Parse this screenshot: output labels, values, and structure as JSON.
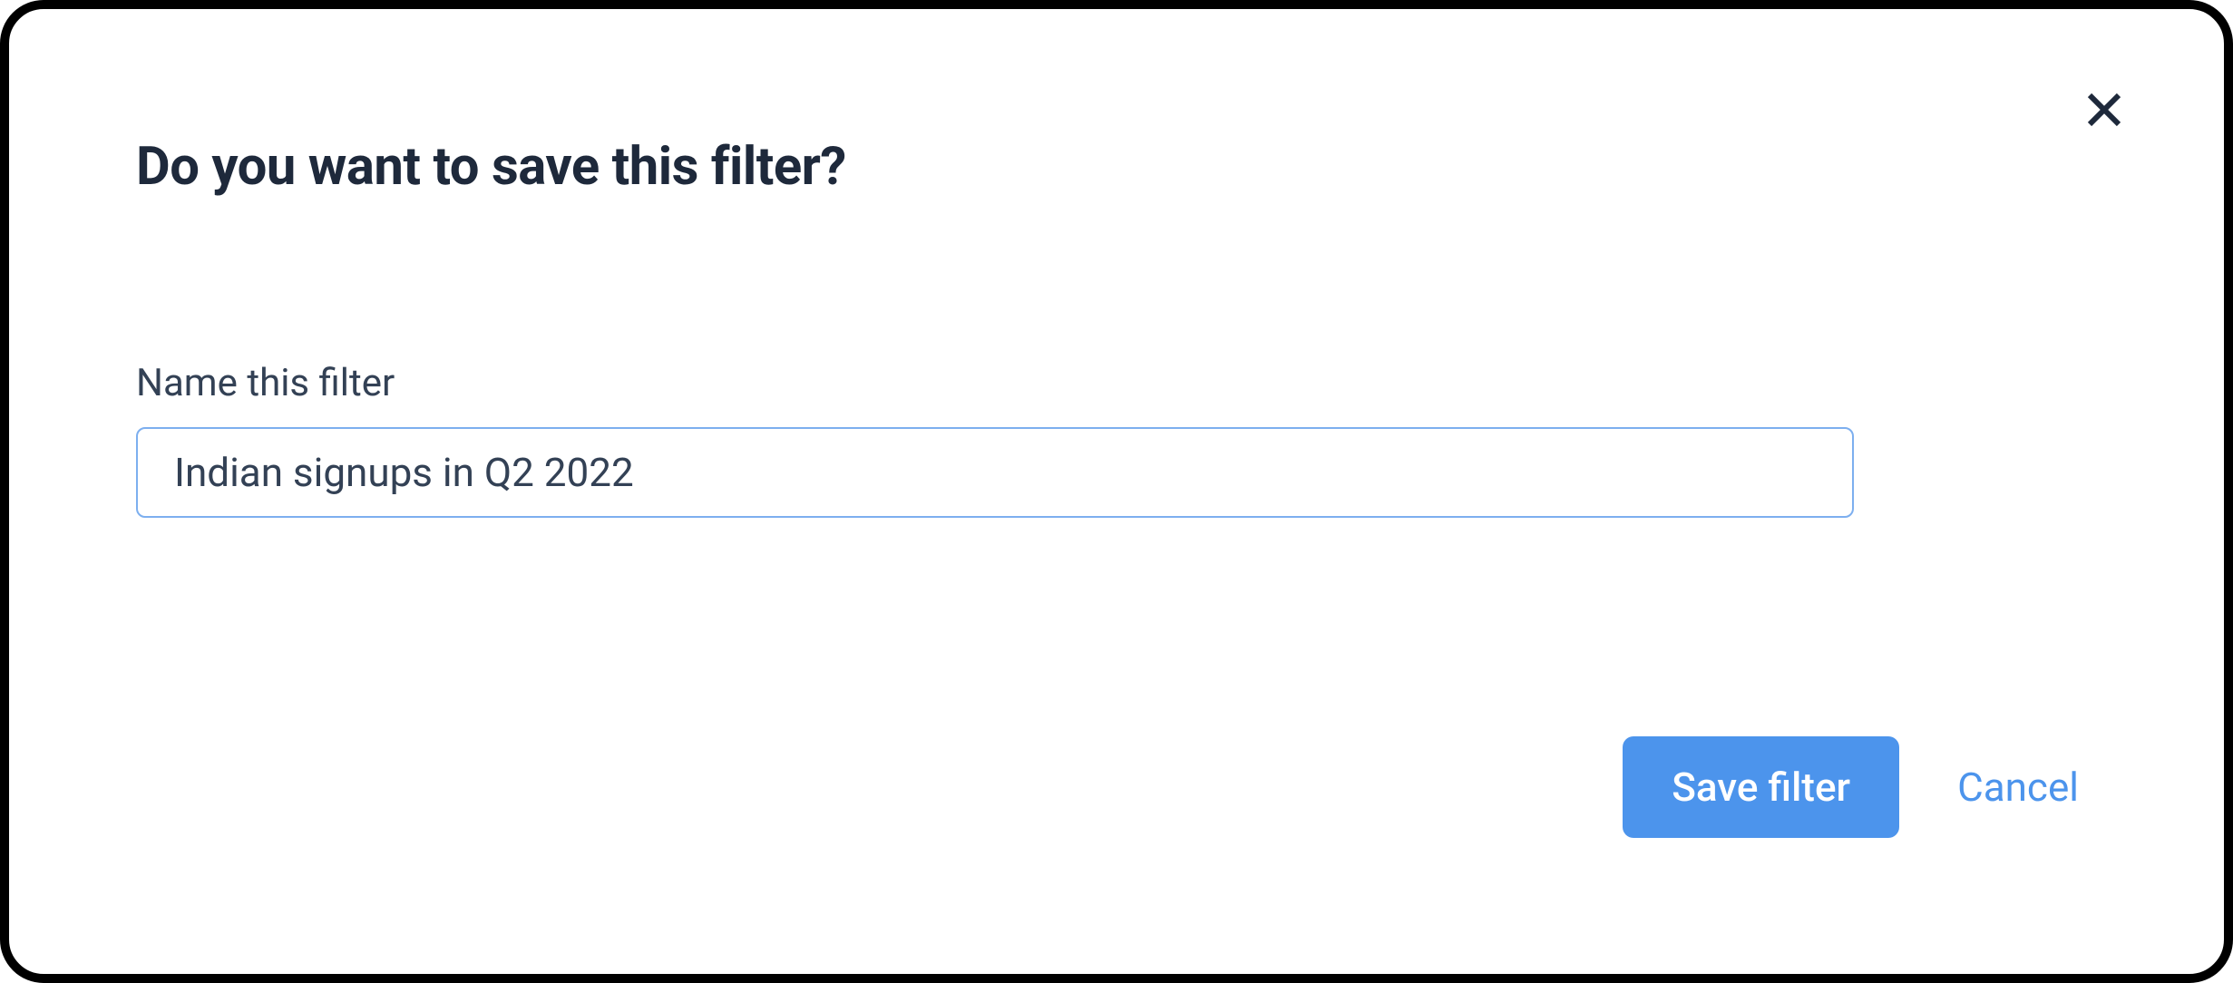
{
  "dialog": {
    "title": "Do you want to save this filter?",
    "field_label": "Name this filter",
    "input_value": "Indian signups in Q2 2022",
    "save_label": "Save filter",
    "cancel_label": "Cancel"
  }
}
